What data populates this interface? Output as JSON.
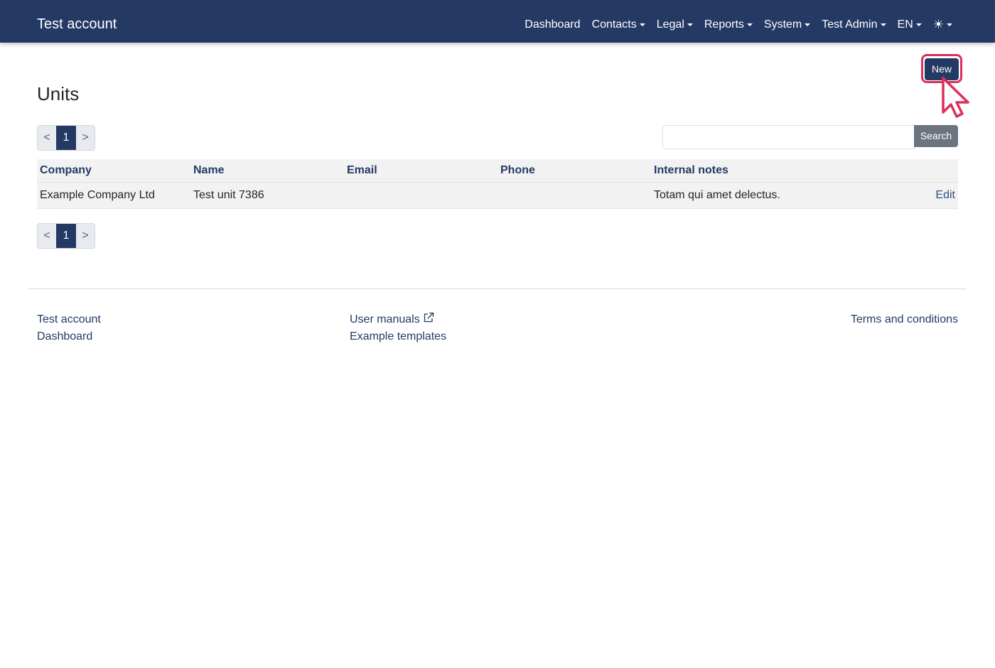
{
  "navbar": {
    "brand": "Test account",
    "items": [
      {
        "label": "Dashboard",
        "dropdown": false
      },
      {
        "label": "Contacts",
        "dropdown": true
      },
      {
        "label": "Legal",
        "dropdown": true
      },
      {
        "label": "Reports",
        "dropdown": true
      },
      {
        "label": "System",
        "dropdown": true
      },
      {
        "label": "Test Admin",
        "dropdown": true
      },
      {
        "label": "EN",
        "dropdown": true
      }
    ],
    "theme_icon": "sun-icon",
    "theme_glyph": "☀"
  },
  "actions": {
    "new_label": "New"
  },
  "page": {
    "title": "Units"
  },
  "pagination": {
    "prev": "<",
    "current": "1",
    "next": ">"
  },
  "search": {
    "value": "",
    "placeholder": "",
    "button_label": "Search"
  },
  "table": {
    "columns": [
      "Company",
      "Name",
      "Email",
      "Phone",
      "Internal notes"
    ],
    "rows": [
      {
        "company": "Example Company Ltd",
        "name": "Test unit 7386",
        "email": "",
        "phone": "",
        "notes": "Totam qui amet delectus.",
        "action": "Edit"
      }
    ]
  },
  "footer": {
    "left_links": [
      "Test account",
      "Dashboard"
    ],
    "middle_links": [
      "User manuals",
      "Example templates"
    ],
    "right_links": [
      "Terms and conditions"
    ]
  },
  "colors": {
    "navbar": "#243a64",
    "primary": "#243a64",
    "highlight": "#dc2f5c",
    "secondary": "#6c757d"
  }
}
